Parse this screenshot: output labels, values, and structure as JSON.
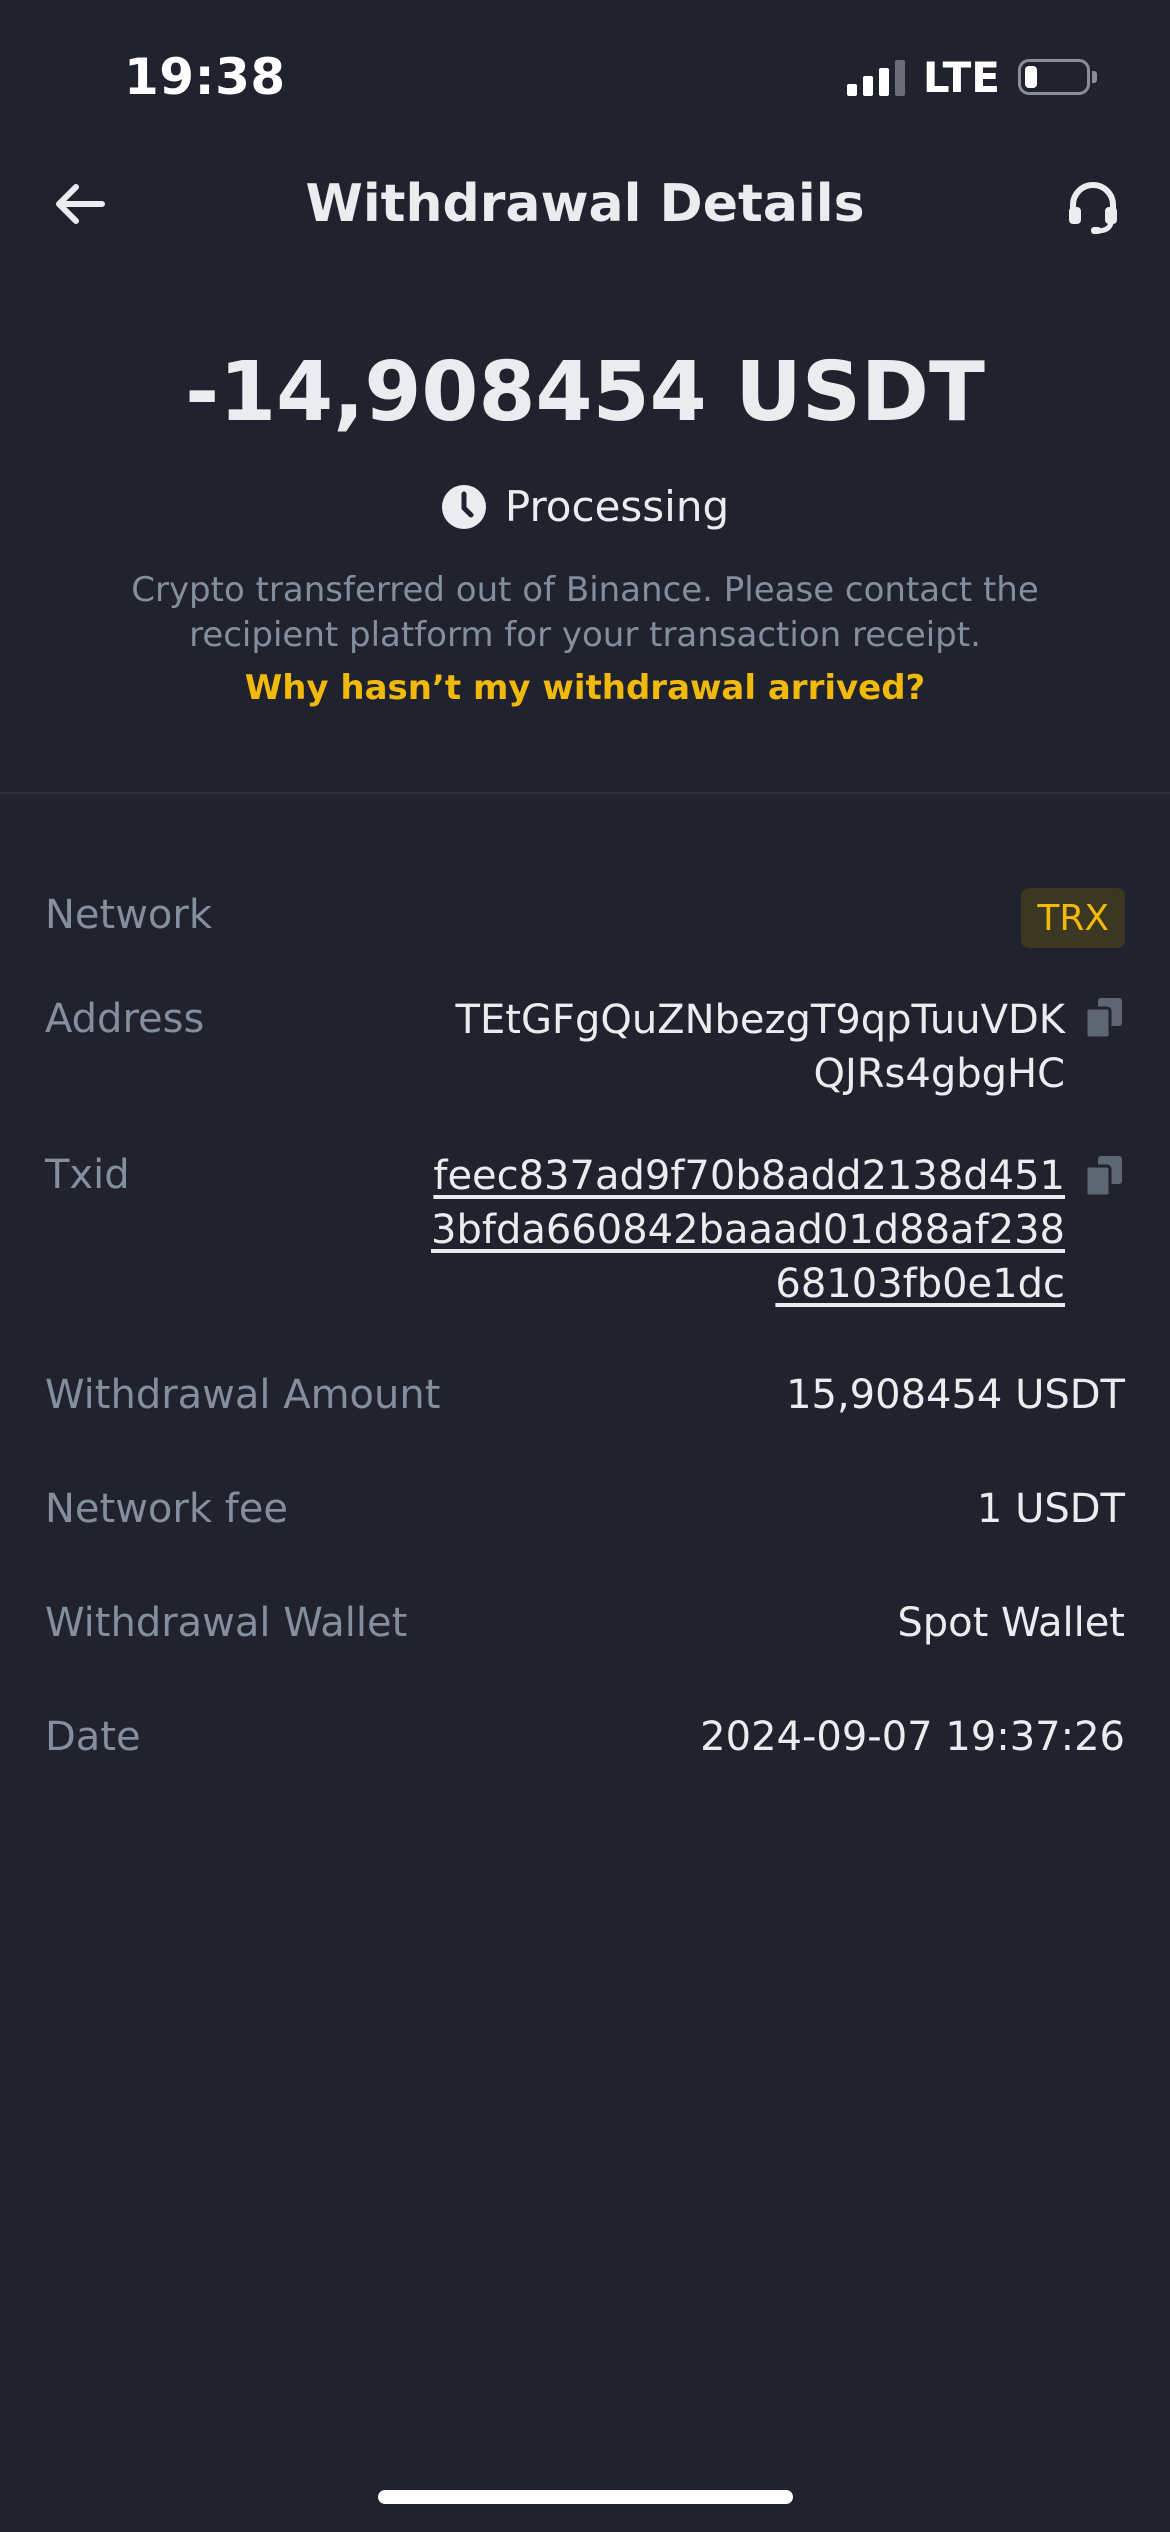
{
  "status_bar": {
    "time": "19:38",
    "network": "LTE"
  },
  "header": {
    "title": "Withdrawal Details",
    "back_icon": "arrow-left-icon",
    "support_icon": "headset-icon"
  },
  "summary": {
    "amount": "-14,908454 USDT",
    "status": "Processing",
    "status_icon": "clock-icon",
    "description": "Crypto transferred out of Binance. Please contact the recipient platform for your transaction receipt.",
    "help_link": "Why hasn’t my withdrawal arrived?"
  },
  "details": {
    "network": {
      "label": "Network",
      "value": "TRX"
    },
    "address": {
      "label": "Address",
      "value": "TEtGFgQuZNbezgT9qpTuuVDK\nQJRs4gbgHC"
    },
    "txid": {
      "label": "Txid",
      "value": "feec837ad9f70b8add2138d451\n3bfda660842baaad01d88af238\n68103fb0e1dc"
    },
    "withdrawal_amount": {
      "label": "Withdrawal Amount",
      "value": "15,908454 USDT"
    },
    "network_fee": {
      "label": "Network fee",
      "value": "1 USDT"
    },
    "withdrawal_wallet": {
      "label": "Withdrawal Wallet",
      "value": "Spot Wallet"
    },
    "date": {
      "label": "Date",
      "value": "2024-09-07 19:37:26"
    }
  },
  "colors": {
    "background": "#20232d",
    "accent": "#f0b90b",
    "muted_text": "#848e9c",
    "primary_text": "#eaecef",
    "badge_bg": "#3c3722"
  }
}
